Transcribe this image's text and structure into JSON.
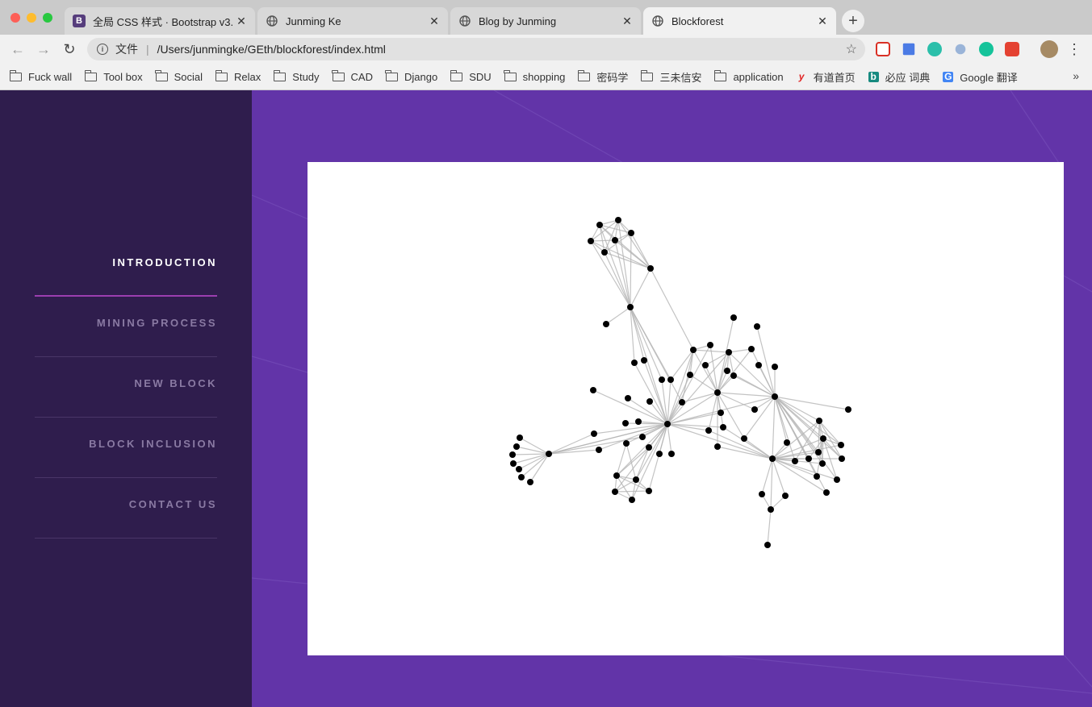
{
  "browser": {
    "tabs": [
      {
        "title": "全局 CSS 样式 · Bootstrap v3.",
        "favicon": "bootstrap-icon",
        "active": false
      },
      {
        "title": "Junming Ke",
        "favicon": "globe-icon",
        "active": false
      },
      {
        "title": "Blog by Junming",
        "favicon": "globe-icon",
        "active": false
      },
      {
        "title": "Blockforest",
        "favicon": "globe-icon",
        "active": true
      }
    ],
    "address": {
      "prefix": "文件",
      "url": "/Users/junmingke/GEth/blockforest/index.html"
    },
    "bookmarks": [
      {
        "label": "Fuck wall",
        "icon": "folder-icon"
      },
      {
        "label": "Tool box",
        "icon": "folder-icon"
      },
      {
        "label": "Social",
        "icon": "folder-icon"
      },
      {
        "label": "Relax",
        "icon": "folder-icon"
      },
      {
        "label": "Study",
        "icon": "folder-icon"
      },
      {
        "label": "CAD",
        "icon": "folder-icon"
      },
      {
        "label": "Django",
        "icon": "folder-icon"
      },
      {
        "label": "SDU",
        "icon": "folder-icon"
      },
      {
        "label": "shopping",
        "icon": "folder-icon"
      },
      {
        "label": "密码学",
        "icon": "folder-icon"
      },
      {
        "label": "三未信安",
        "icon": "folder-icon"
      },
      {
        "label": "application",
        "icon": "folder-icon"
      },
      {
        "label": "有道首页",
        "icon": "youdao-icon"
      },
      {
        "label": "必应 词典",
        "icon": "bing-icon"
      },
      {
        "label": "Google 翻译",
        "icon": "google-translate-icon"
      }
    ]
  },
  "colors": {
    "sidebar_bg": "#2f1d4d",
    "main_bg": "#6234a8",
    "accent": "#9b3fb0",
    "node": "#000000",
    "edge": "#b4b4b4"
  },
  "sidebar": {
    "items": [
      {
        "label": "INTRODUCTION",
        "active": true
      },
      {
        "label": "MINING PROCESS",
        "active": false
      },
      {
        "label": "NEW BLOCK",
        "active": false
      },
      {
        "label": "BLOCK INCLUSION",
        "active": false
      },
      {
        "label": "CONTACT US",
        "active": false
      }
    ]
  }
}
